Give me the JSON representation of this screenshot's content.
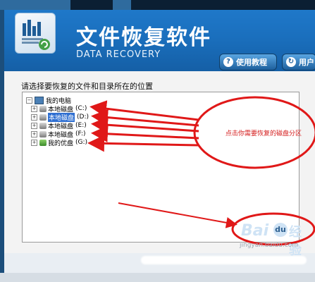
{
  "app": {
    "title": "文件恢复软件",
    "subtitle": "DATA RECOVERY"
  },
  "header": {
    "buttons": [
      {
        "label": "使用教程",
        "icon": "question-icon"
      },
      {
        "label": "用户",
        "icon": "refresh-icon"
      }
    ]
  },
  "panel": {
    "instruction": "请选择要恢复的文件和目录所在的位置"
  },
  "tree": {
    "root": {
      "label": "我的电脑",
      "toggle": "⊟"
    },
    "items": [
      {
        "label": "本地磁盘",
        "drive": "(C:)",
        "toggle": "⊞",
        "selected": false
      },
      {
        "label": "本地磁盘",
        "drive": "(D:)",
        "toggle": "⊞",
        "selected": true
      },
      {
        "label": "本地磁盘",
        "drive": "(E:)",
        "toggle": "⊞",
        "selected": false
      },
      {
        "label": "本地磁盘",
        "drive": "(F:)",
        "toggle": "⊞",
        "selected": false
      },
      {
        "label": "我的优盘",
        "drive": "(G:)",
        "toggle": "⊞",
        "selected": false
      }
    ]
  },
  "annotation": {
    "text": "点击你需要恢复的磁盘分区",
    "color": "#d41c1c"
  },
  "watermark": {
    "brand": "Bai",
    "brand2": "经验",
    "url": "jingyan.baidu.com"
  },
  "colors": {
    "header_blue": "#1a6fbd",
    "selection_blue": "#2f6fd1",
    "annotation_red": "#e01818"
  }
}
